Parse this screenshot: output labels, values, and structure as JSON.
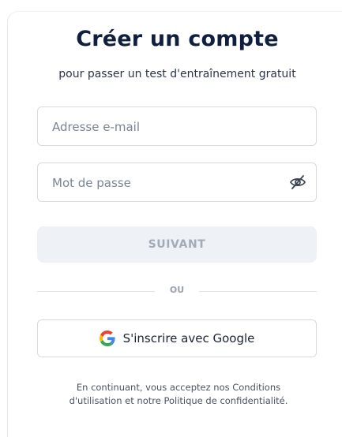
{
  "header": {
    "title": "Créer un compte",
    "subtitle": "pour passer un test d'entraînement gratuit"
  },
  "form": {
    "email_placeholder": "Adresse e-mail",
    "password_placeholder": "Mot de passe",
    "password_toggle_icon": "eye-off-icon",
    "next_label": "SUIVANT"
  },
  "separator": {
    "label": "OU"
  },
  "google": {
    "label": "S'inscrire avec Google",
    "icon": "google-icon",
    "colors": {
      "blue": "#4285F4",
      "red": "#EA4335",
      "yellow": "#FBBC05",
      "green": "#34A853"
    }
  },
  "legal": {
    "line1": "En continuant, vous acceptez nos Conditions",
    "line2": "d'utilisation et notre Politique de confidentialité."
  },
  "colors": {
    "title": "#0f1f3d",
    "button_disabled_bg": "#eef1f5",
    "button_disabled_text": "#a3abb8"
  }
}
